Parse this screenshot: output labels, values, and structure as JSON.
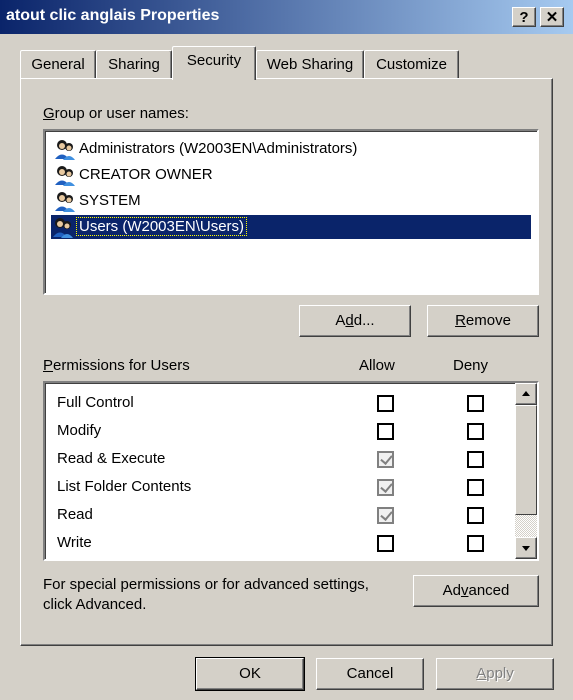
{
  "window": {
    "title": "atout clic anglais Properties",
    "help_label": "?",
    "close_label": "✕"
  },
  "tabs": [
    {
      "label": "General"
    },
    {
      "label": "Sharing"
    },
    {
      "label": "Security"
    },
    {
      "label": "Web Sharing"
    },
    {
      "label": "Customize"
    }
  ],
  "groups": {
    "label_prefix": "G",
    "label_rest": "roup or user names:",
    "items": [
      {
        "label": "Administrators (W2003EN\\Administrators)"
      },
      {
        "label": "CREATOR OWNER"
      },
      {
        "label": "SYSTEM"
      },
      {
        "label": "Users (W2003EN\\Users)",
        "selected": true
      }
    ],
    "add_a": "A",
    "add_u": "d",
    "add_rest": "d...",
    "remove_u": "R",
    "remove_rest": "emove"
  },
  "permissions": {
    "label_u": "P",
    "label_rest": "ermissions for Users",
    "allow_header": "Allow",
    "deny_header": "Deny",
    "rows": [
      {
        "name": "Full Control",
        "allow": false,
        "deny": false
      },
      {
        "name": "Modify",
        "allow": false,
        "deny": false
      },
      {
        "name": "Read & Execute",
        "allow": true,
        "deny": false
      },
      {
        "name": "List Folder Contents",
        "allow": true,
        "deny": false
      },
      {
        "name": "Read",
        "allow": true,
        "deny": false
      },
      {
        "name": "Write",
        "allow": false,
        "deny": false
      }
    ]
  },
  "advanced": {
    "text_line1": "For special permissions or for advanced settings,",
    "text_line2": "click Advanced.",
    "btn_a": "Ad",
    "btn_u": "v",
    "btn_rest": "anced"
  },
  "footer": {
    "ok_label": "OK",
    "cancel_label": "Cancel",
    "apply_u": "A",
    "apply_rest": "pply"
  }
}
